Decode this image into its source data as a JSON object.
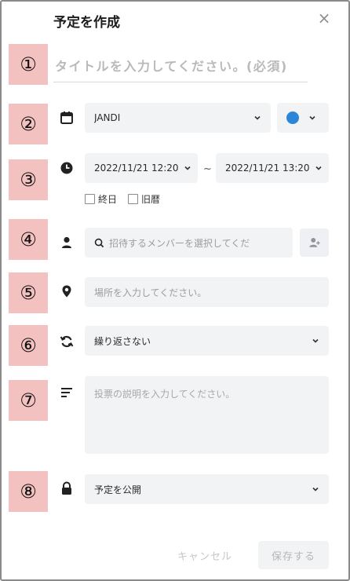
{
  "dialog": {
    "title": "予定を作成",
    "close_symbol": "×"
  },
  "markers": [
    "①",
    "②",
    "③",
    "④",
    "⑤",
    "⑥",
    "⑦",
    "⑧"
  ],
  "title_field": {
    "placeholder": "タイトルを入力してください。(必須)",
    "value": ""
  },
  "calendar": {
    "icon": "calendar-icon",
    "selected": "JANDI",
    "color": "#2b86d8"
  },
  "datetime": {
    "icon": "clock-icon",
    "start": "2022/11/21 12:20",
    "separator": "~",
    "end": "2022/11/21 13:20",
    "all_day_label": "終日",
    "lunar_label": "旧暦"
  },
  "members": {
    "icon": "person-icon",
    "placeholder": "招待するメンバーを選択してくだ",
    "add_icon": "add-person-icon"
  },
  "location": {
    "icon": "location-pin-icon",
    "placeholder": "場所を入力してください。"
  },
  "repeat": {
    "icon": "repeat-icon",
    "selected": "繰り返さない"
  },
  "description": {
    "icon": "text-lines-icon",
    "placeholder": "投票の説明を入力してください。"
  },
  "visibility": {
    "icon": "lock-icon",
    "selected": "予定を公開"
  },
  "footer": {
    "cancel_label": "キャンセル",
    "save_label": "保存する"
  }
}
